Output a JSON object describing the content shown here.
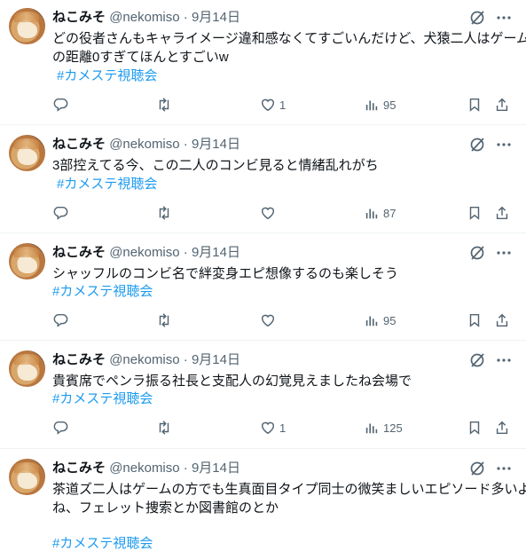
{
  "tweets": [
    {
      "name": "ねこみそ",
      "handle": "@nekomiso",
      "date": "9月14日",
      "lines": [
        "どの役者さんもキャライメージ違和感なくてすごいんだけど、犬猿二人はゲームと",
        "の距離0すぎてほんとすごいw"
      ],
      "hashtag": "#カメステ視聴会",
      "likes": "1",
      "views": "95"
    },
    {
      "name": "ねこみそ",
      "handle": "@nekomiso",
      "date": "9月14日",
      "lines": [
        "3部控えてる今、この二人のコンビ見ると情緒乱れがち"
      ],
      "hashtag": "#カメステ視聴会",
      "likes": "",
      "views": "87"
    },
    {
      "name": "ねこみそ",
      "handle": "@nekomiso",
      "date": "9月14日",
      "lines": [
        "シャッフルのコンビ名で絆変身エピ想像するのも楽しそう"
      ],
      "hashtag": "#カメステ視聴会",
      "likes": "",
      "views": "95"
    },
    {
      "name": "ねこみそ",
      "handle": "@nekomiso",
      "date": "9月14日",
      "lines": [
        "貴賓席でペンラ振る社長と支配人の幻覚見えましたね会場で"
      ],
      "hashtag": "#カメステ視聴会",
      "likes": "1",
      "views": "125"
    },
    {
      "name": "ねこみそ",
      "handle": "@nekomiso",
      "date": "9月14日",
      "lines": [
        "茶道ズ二人はゲームの方でも生真面目タイプ同士の微笑ましいエピソード多いよ",
        "ね、フェレット捜索とか図書館のとか"
      ],
      "hashtag": "#カメステ視聴会",
      "likes": "",
      "views": ""
    }
  ],
  "icons": {
    "reply": "reply-icon",
    "retweet": "retweet-icon",
    "like": "heart-icon",
    "views": "analytics-icon",
    "bookmark": "bookmark-icon",
    "share": "share-icon",
    "grok": "grok-icon",
    "more": "more-icon"
  },
  "colors": {
    "text": "#0f1419",
    "secondary": "#536471",
    "hashtag": "#1d9bf0",
    "divider": "#eff3f4"
  }
}
